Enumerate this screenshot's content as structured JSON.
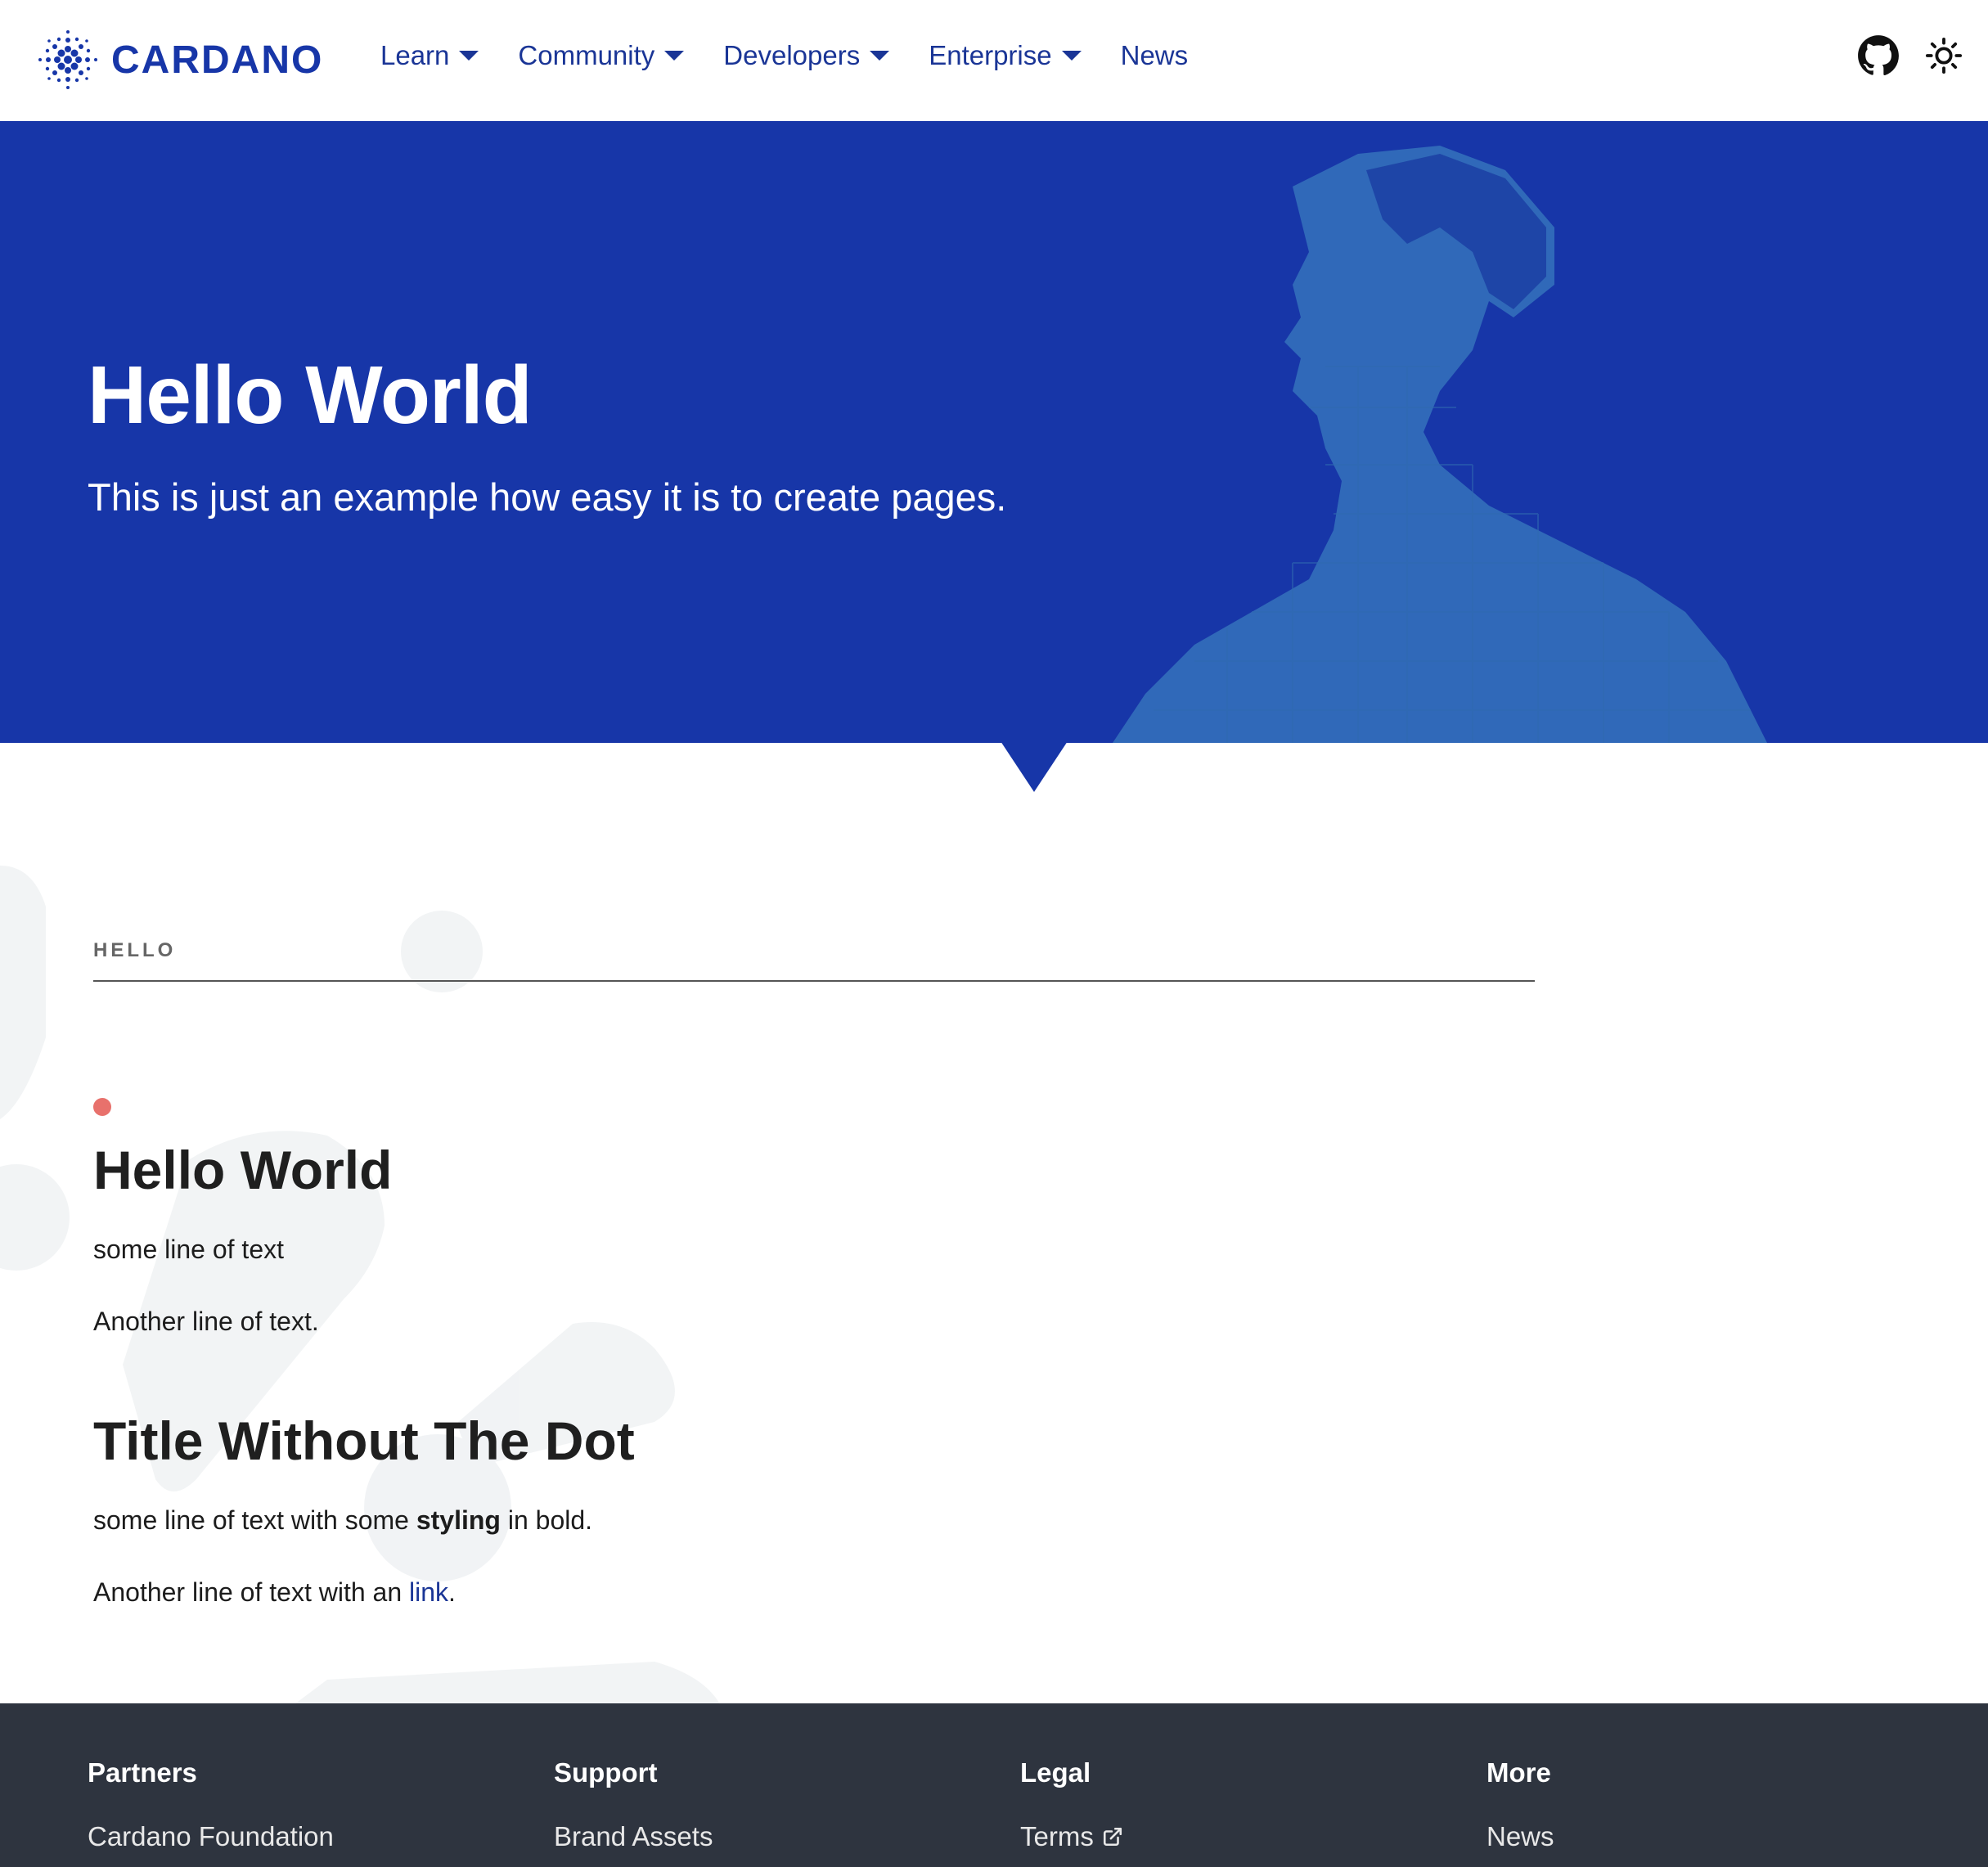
{
  "brand": {
    "name": "CARDANO",
    "color": "#1736a8"
  },
  "nav": {
    "items": [
      {
        "label": "Learn",
        "has_dropdown": true
      },
      {
        "label": "Community",
        "has_dropdown": true
      },
      {
        "label": "Developers",
        "has_dropdown": true
      },
      {
        "label": "Enterprise",
        "has_dropdown": true
      },
      {
        "label": "News",
        "has_dropdown": false
      }
    ],
    "icons": [
      "github-icon",
      "sun-icon"
    ]
  },
  "hero": {
    "title": "Hello World",
    "subtitle": "This is just an example how easy it is to create pages."
  },
  "content": {
    "kicker": "HELLO",
    "section1": {
      "title": "Hello World",
      "line1": "some line of text",
      "line2": "Another line of text."
    },
    "section2": {
      "title": "Title Without The Dot",
      "line1_before": "some line of text with some ",
      "line1_bold": "styling",
      "line1_after": " in bold.",
      "line2_before": "Another line of text with an ",
      "line2_link": "link",
      "line2_after": "."
    },
    "dot_color": "#e8716c"
  },
  "footer": {
    "columns": [
      {
        "heading": "Partners",
        "link": "Cardano Foundation",
        "external": false
      },
      {
        "heading": "Support",
        "link": "Brand Assets",
        "external": false
      },
      {
        "heading": "Legal",
        "link": "Terms",
        "external": true
      },
      {
        "heading": "More",
        "link": "News",
        "external": false
      }
    ]
  }
}
